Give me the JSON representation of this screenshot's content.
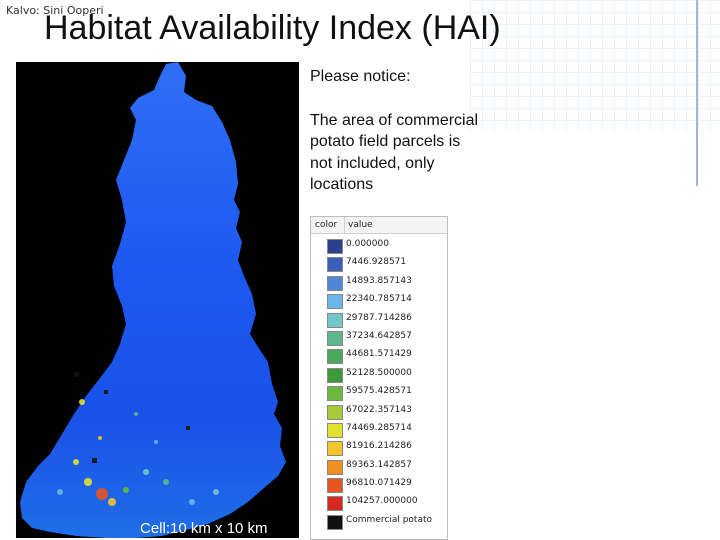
{
  "slide": {
    "credit": "Kalvo: Sini Ooperi",
    "title": "Habitat Availability Index (HAI)"
  },
  "notice": {
    "heading": "Please notice:",
    "body": "The  area of commercial potato field parcels is not included, only locations"
  },
  "map": {
    "cell_label": "Cell:10 km x 10 km"
  },
  "legend": {
    "col_color": "color",
    "col_value": "value",
    "items": [
      {
        "value": "0.000000",
        "color": "#2c3e8f"
      },
      {
        "value": "7446.928571",
        "color": "#3a5fb8"
      },
      {
        "value": "14893.857143",
        "color": "#4f86d6"
      },
      {
        "value": "22340.785714",
        "color": "#6bb6e6"
      },
      {
        "value": "29787.714286",
        "color": "#74c7c9"
      },
      {
        "value": "37234.642857",
        "color": "#5cb88a"
      },
      {
        "value": "44681.571429",
        "color": "#4aa85a"
      },
      {
        "value": "52128.500000",
        "color": "#3d9a3a"
      },
      {
        "value": "59575.428571",
        "color": "#6cb83a"
      },
      {
        "value": "67022.357143",
        "color": "#a6cc3a"
      },
      {
        "value": "74469.285714",
        "color": "#dfe22f"
      },
      {
        "value": "81916.214286",
        "color": "#f2c52a"
      },
      {
        "value": "89363.142857",
        "color": "#ef8f1f"
      },
      {
        "value": "96810.071429",
        "color": "#e55521"
      },
      {
        "value": "104257.000000",
        "color": "#d62a21"
      },
      {
        "value": "Commercial potato",
        "color": "#111111"
      }
    ]
  }
}
